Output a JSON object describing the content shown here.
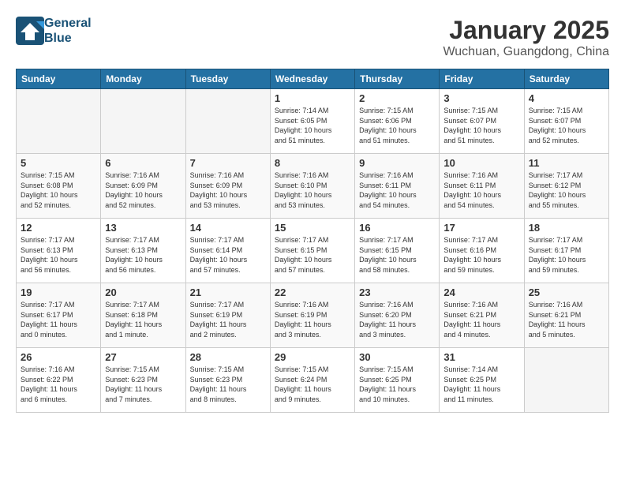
{
  "header": {
    "logo": {
      "line1": "General",
      "line2": "Blue"
    },
    "title": "January 2025",
    "subtitle": "Wuchuan, Guangdong, China"
  },
  "weekdays": [
    "Sunday",
    "Monday",
    "Tuesday",
    "Wednesday",
    "Thursday",
    "Friday",
    "Saturday"
  ],
  "weeks": [
    [
      {
        "day": "",
        "info": ""
      },
      {
        "day": "",
        "info": ""
      },
      {
        "day": "",
        "info": ""
      },
      {
        "day": "1",
        "info": "Sunrise: 7:14 AM\nSunset: 6:05 PM\nDaylight: 10 hours\nand 51 minutes."
      },
      {
        "day": "2",
        "info": "Sunrise: 7:15 AM\nSunset: 6:06 PM\nDaylight: 10 hours\nand 51 minutes."
      },
      {
        "day": "3",
        "info": "Sunrise: 7:15 AM\nSunset: 6:07 PM\nDaylight: 10 hours\nand 51 minutes."
      },
      {
        "day": "4",
        "info": "Sunrise: 7:15 AM\nSunset: 6:07 PM\nDaylight: 10 hours\nand 52 minutes."
      }
    ],
    [
      {
        "day": "5",
        "info": "Sunrise: 7:15 AM\nSunset: 6:08 PM\nDaylight: 10 hours\nand 52 minutes."
      },
      {
        "day": "6",
        "info": "Sunrise: 7:16 AM\nSunset: 6:09 PM\nDaylight: 10 hours\nand 52 minutes."
      },
      {
        "day": "7",
        "info": "Sunrise: 7:16 AM\nSunset: 6:09 PM\nDaylight: 10 hours\nand 53 minutes."
      },
      {
        "day": "8",
        "info": "Sunrise: 7:16 AM\nSunset: 6:10 PM\nDaylight: 10 hours\nand 53 minutes."
      },
      {
        "day": "9",
        "info": "Sunrise: 7:16 AM\nSunset: 6:11 PM\nDaylight: 10 hours\nand 54 minutes."
      },
      {
        "day": "10",
        "info": "Sunrise: 7:16 AM\nSunset: 6:11 PM\nDaylight: 10 hours\nand 54 minutes."
      },
      {
        "day": "11",
        "info": "Sunrise: 7:17 AM\nSunset: 6:12 PM\nDaylight: 10 hours\nand 55 minutes."
      }
    ],
    [
      {
        "day": "12",
        "info": "Sunrise: 7:17 AM\nSunset: 6:13 PM\nDaylight: 10 hours\nand 56 minutes."
      },
      {
        "day": "13",
        "info": "Sunrise: 7:17 AM\nSunset: 6:13 PM\nDaylight: 10 hours\nand 56 minutes."
      },
      {
        "day": "14",
        "info": "Sunrise: 7:17 AM\nSunset: 6:14 PM\nDaylight: 10 hours\nand 57 minutes."
      },
      {
        "day": "15",
        "info": "Sunrise: 7:17 AM\nSunset: 6:15 PM\nDaylight: 10 hours\nand 57 minutes."
      },
      {
        "day": "16",
        "info": "Sunrise: 7:17 AM\nSunset: 6:15 PM\nDaylight: 10 hours\nand 58 minutes."
      },
      {
        "day": "17",
        "info": "Sunrise: 7:17 AM\nSunset: 6:16 PM\nDaylight: 10 hours\nand 59 minutes."
      },
      {
        "day": "18",
        "info": "Sunrise: 7:17 AM\nSunset: 6:17 PM\nDaylight: 10 hours\nand 59 minutes."
      }
    ],
    [
      {
        "day": "19",
        "info": "Sunrise: 7:17 AM\nSunset: 6:17 PM\nDaylight: 11 hours\nand 0 minutes."
      },
      {
        "day": "20",
        "info": "Sunrise: 7:17 AM\nSunset: 6:18 PM\nDaylight: 11 hours\nand 1 minute."
      },
      {
        "day": "21",
        "info": "Sunrise: 7:17 AM\nSunset: 6:19 PM\nDaylight: 11 hours\nand 2 minutes."
      },
      {
        "day": "22",
        "info": "Sunrise: 7:16 AM\nSunset: 6:19 PM\nDaylight: 11 hours\nand 3 minutes."
      },
      {
        "day": "23",
        "info": "Sunrise: 7:16 AM\nSunset: 6:20 PM\nDaylight: 11 hours\nand 3 minutes."
      },
      {
        "day": "24",
        "info": "Sunrise: 7:16 AM\nSunset: 6:21 PM\nDaylight: 11 hours\nand 4 minutes."
      },
      {
        "day": "25",
        "info": "Sunrise: 7:16 AM\nSunset: 6:21 PM\nDaylight: 11 hours\nand 5 minutes."
      }
    ],
    [
      {
        "day": "26",
        "info": "Sunrise: 7:16 AM\nSunset: 6:22 PM\nDaylight: 11 hours\nand 6 minutes."
      },
      {
        "day": "27",
        "info": "Sunrise: 7:15 AM\nSunset: 6:23 PM\nDaylight: 11 hours\nand 7 minutes."
      },
      {
        "day": "28",
        "info": "Sunrise: 7:15 AM\nSunset: 6:23 PM\nDaylight: 11 hours\nand 8 minutes."
      },
      {
        "day": "29",
        "info": "Sunrise: 7:15 AM\nSunset: 6:24 PM\nDaylight: 11 hours\nand 9 minutes."
      },
      {
        "day": "30",
        "info": "Sunrise: 7:15 AM\nSunset: 6:25 PM\nDaylight: 11 hours\nand 10 minutes."
      },
      {
        "day": "31",
        "info": "Sunrise: 7:14 AM\nSunset: 6:25 PM\nDaylight: 11 hours\nand 11 minutes."
      },
      {
        "day": "",
        "info": ""
      }
    ]
  ]
}
